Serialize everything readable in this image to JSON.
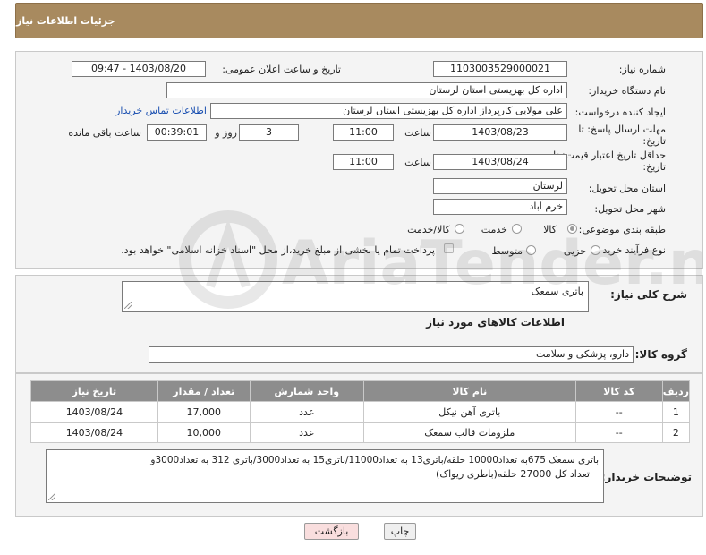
{
  "header": {
    "title": "جزئیات اطلاعات نیاز"
  },
  "form": {
    "need_number": {
      "label": "شماره نیاز:",
      "value": "1103003529000021"
    },
    "announce_datetime": {
      "label": "تاریخ و ساعت اعلان عمومی:",
      "value": "1403/08/20 - 09:47"
    },
    "buyer_org": {
      "label": "نام دستگاه خریدار:",
      "value": "اداره کل بهزیستی استان لرستان"
    },
    "requester": {
      "label": "ایجاد کننده درخواست:",
      "value": "علی مولایی کارپرداز اداره کل بهزیستی استان لرستان",
      "contact_link": "اطلاعات تماس خریدار"
    },
    "reply_deadline": {
      "label_line1": "مهلت ارسال پاسخ: تا",
      "label_line2": "تاریخ:",
      "date": "1403/08/23",
      "time_label": "ساعت",
      "time": "11:00",
      "days": "3",
      "days_label": "روز و",
      "remaining": "00:39:01",
      "remaining_label": "ساعت باقی مانده"
    },
    "price_validity": {
      "label_line1": "حداقل تاریخ اعتبار قیمت: تا",
      "label_line2": "تاریخ:",
      "date": "1403/08/24",
      "time_label": "ساعت",
      "time": "11:00"
    },
    "delivery_province": {
      "label": "استان محل تحویل:",
      "value": "لرستان"
    },
    "delivery_city": {
      "label": "شهر محل تحویل:",
      "value": "خرم آباد"
    },
    "category": {
      "label": "طبقه بندی موضوعی:",
      "options": [
        "کالا",
        "خدمت",
        "کالا/خدمت"
      ],
      "selected": "کالا"
    },
    "purchase_type": {
      "label": "نوع فرآیند خرید :",
      "options": [
        "جزیی",
        "متوسط"
      ],
      "selected": "",
      "note": "پرداخت تمام یا بخشی از مبلغ خرید،از محل \"اسناد خزانه اسلامی\" خواهد بود."
    }
  },
  "summary": {
    "label": "شرح کلی نیاز:",
    "value": "باتری سمعک",
    "items_title": "اطلاعات کالاهای مورد نیاز",
    "group_label": "گروه کالا:",
    "group_value": "دارو، پزشکی و سلامت"
  },
  "table": {
    "headers": [
      "ردیف",
      "کد کالا",
      "نام کالا",
      "واحد شمارش",
      "تعداد / مقدار",
      "تاریخ نیاز"
    ],
    "rows": [
      [
        "1",
        "--",
        "باتری آهن نیکل",
        "عدد",
        "17,000",
        "1403/08/24"
      ],
      [
        "2",
        "--",
        "ملزومات قالب سمعک",
        "عدد",
        "10,000",
        "1403/08/24"
      ]
    ]
  },
  "buyer_notes": {
    "label": "توضیحات خریدار:",
    "line1": "باتری سمعک 675به تعداد10000 حلقه/باتری13 به تعداد11000/باتری15 به تعداد3000/باتری 312 به تعداد3000و",
    "line2": "تعداد کل 27000 حلقه(باطری ریواک)"
  },
  "buttons": {
    "print": "چاپ",
    "back": "بازگشت"
  },
  "watermark": {
    "text": "AriaTender.neT"
  },
  "colors": {
    "header_bg": "#a88a5f",
    "table_header_bg": "#8d8d8d",
    "back_button_bg": "#f9dede",
    "link": "#1a4fb0"
  }
}
